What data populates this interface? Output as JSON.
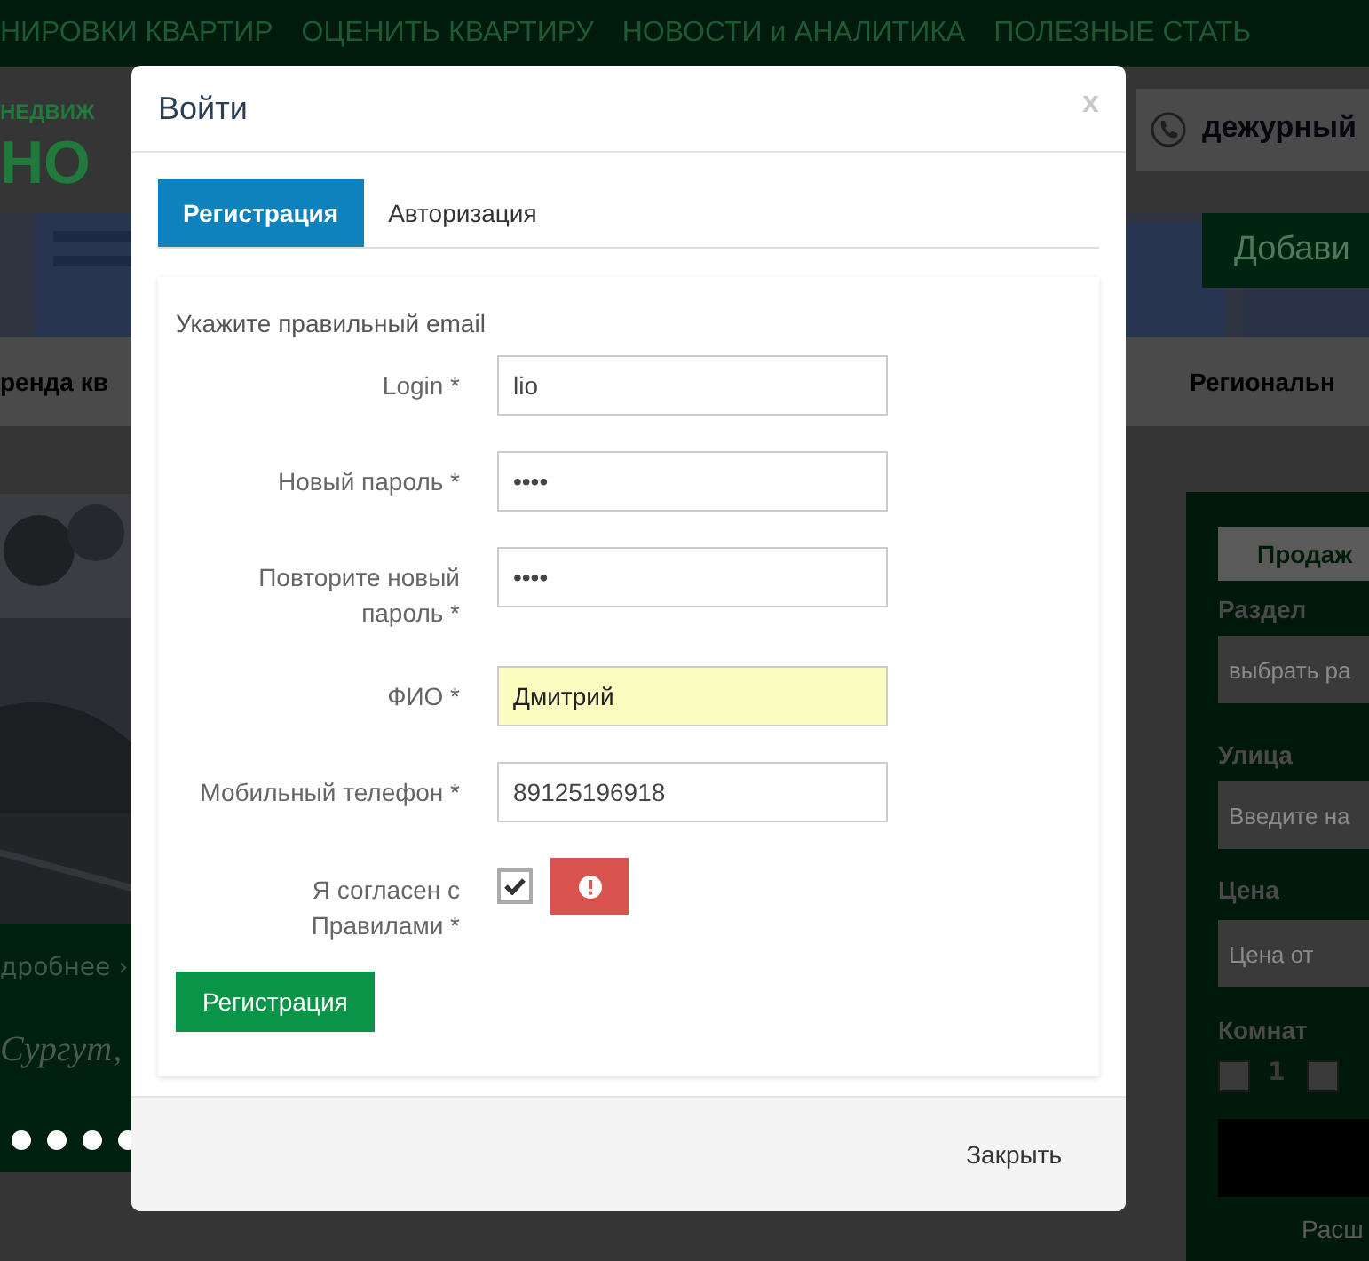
{
  "background": {
    "nav": [
      "НИРОВКИ КВАРТИР",
      "ОЦЕНИТЬ КВАРТИРУ",
      "НОВОСТИ и АНАЛИТИКА",
      "ПОЛЕЗНЫЕ СТАТЬ"
    ],
    "logo": {
      "line1": "НЕДВИЖ",
      "line2": "НО"
    },
    "phone": "дежурный",
    "add_button": "Добави",
    "banner_left": "ренда кв",
    "banner_right": "Региональн",
    "slider": {
      "more": "дробнее",
      "more_arrow": "›",
      "caption": "Сургут,"
    },
    "search_panel": {
      "tab": "Продаж",
      "section_label": "Раздел",
      "section_value": "выбрать ра",
      "street_label": "Улица",
      "street_placeholder": "Введите на",
      "price_label": "Цена",
      "price_placeholder": "Цена от",
      "rooms_label": "Комнат",
      "rooms": [
        {
          "label": "1",
          "checked": false
        },
        {
          "checked": false
        }
      ],
      "expand_link": "Расш"
    }
  },
  "dialog": {
    "title": "Войти",
    "close": "x",
    "tabs": [
      {
        "label": "Регистрация",
        "selected": true
      },
      {
        "label": "Авторизация",
        "selected": false
      }
    ],
    "message": "Укажите правильный email",
    "fields": [
      {
        "kind": "input",
        "label": "Login *",
        "value": "lio",
        "autofilled": false
      },
      {
        "kind": "input",
        "label": "Новый пароль *",
        "value": "••••",
        "autofilled": false
      },
      {
        "kind": "input",
        "label": "Повторите новый пароль *",
        "value": "••••",
        "autofilled": false
      },
      {
        "kind": "input",
        "label": "ФИО *",
        "value": "Дмитрий",
        "autofilled": true
      },
      {
        "kind": "input",
        "label": "Мобильный телефон *",
        "value": "89125196918",
        "autofilled": false
      },
      {
        "kind": "checkbox",
        "label": "Я согласен с Правилами *",
        "checked": true,
        "error": true
      }
    ],
    "submit": "Регистрация",
    "footer_button": "Закрыть"
  }
}
